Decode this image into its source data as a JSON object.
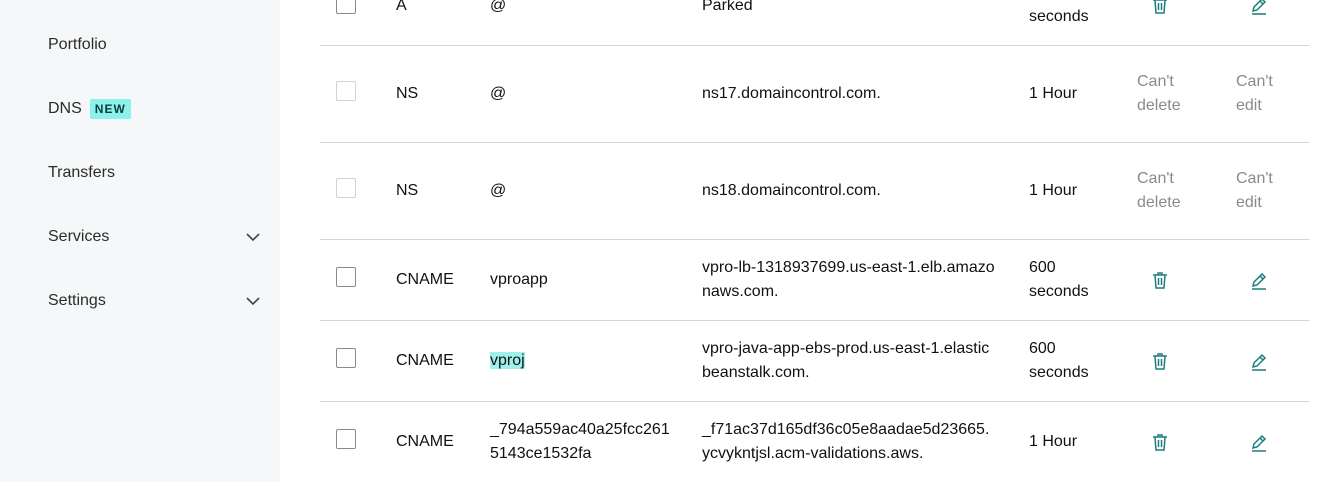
{
  "sidebar": {
    "items": [
      {
        "label": "Portfolio"
      },
      {
        "label": "DNS",
        "badge": "NEW"
      },
      {
        "label": "Transfers"
      },
      {
        "label": "Services"
      },
      {
        "label": "Settings"
      }
    ]
  },
  "records": [
    {
      "type": "A",
      "name": "@",
      "value_lines": [
        "Parked"
      ],
      "ttl_lines": [
        "seconds"
      ],
      "delete": "icon",
      "edit": "icon"
    },
    {
      "type": "NS",
      "name": "@",
      "value_lines": [
        "ns17.domaincontrol.com."
      ],
      "ttl_lines": [
        "1 Hour"
      ],
      "delete_lines": [
        "Can't",
        "delete"
      ],
      "edit_lines": [
        "Can't",
        "edit"
      ]
    },
    {
      "type": "NS",
      "name": "@",
      "value_lines": [
        "ns18.domaincontrol.com."
      ],
      "ttl_lines": [
        "1 Hour"
      ],
      "delete_lines": [
        "Can't",
        "delete"
      ],
      "edit_lines": [
        "Can't",
        "edit"
      ]
    },
    {
      "type": "CNAME",
      "name_lines": [
        "vproapp"
      ],
      "value_lines": [
        "vpro-lb-1318937699.us-east-1.elb.amazo",
        "naws.com."
      ],
      "ttl_lines": [
        "600",
        "seconds"
      ]
    },
    {
      "type": "CNAME",
      "name_lines": [
        "vproj"
      ],
      "value_lines": [
        "vpro-java-app-ebs-prod.us-east-1.elastic",
        "beanstalk.com."
      ],
      "ttl_lines": [
        "600",
        "seconds"
      ]
    },
    {
      "type": "CNAME",
      "name_lines": [
        "_794a559ac40a25fcc261",
        "5143ce1532fa"
      ],
      "value_lines": [
        "_f71ac37d165df36c05e8aadae5d23665.",
        "ycvykntjsl.acm-validations.aws."
      ],
      "ttl_lines": [
        "1 Hour"
      ]
    }
  ],
  "colors": {
    "accent": "#1b7f79",
    "highlight": "#9ef0ec",
    "badge": "#8cf0ec"
  },
  "icons": {
    "delete": "trash-icon",
    "edit": "pencil-icon",
    "expand": "chevron-down-icon"
  }
}
